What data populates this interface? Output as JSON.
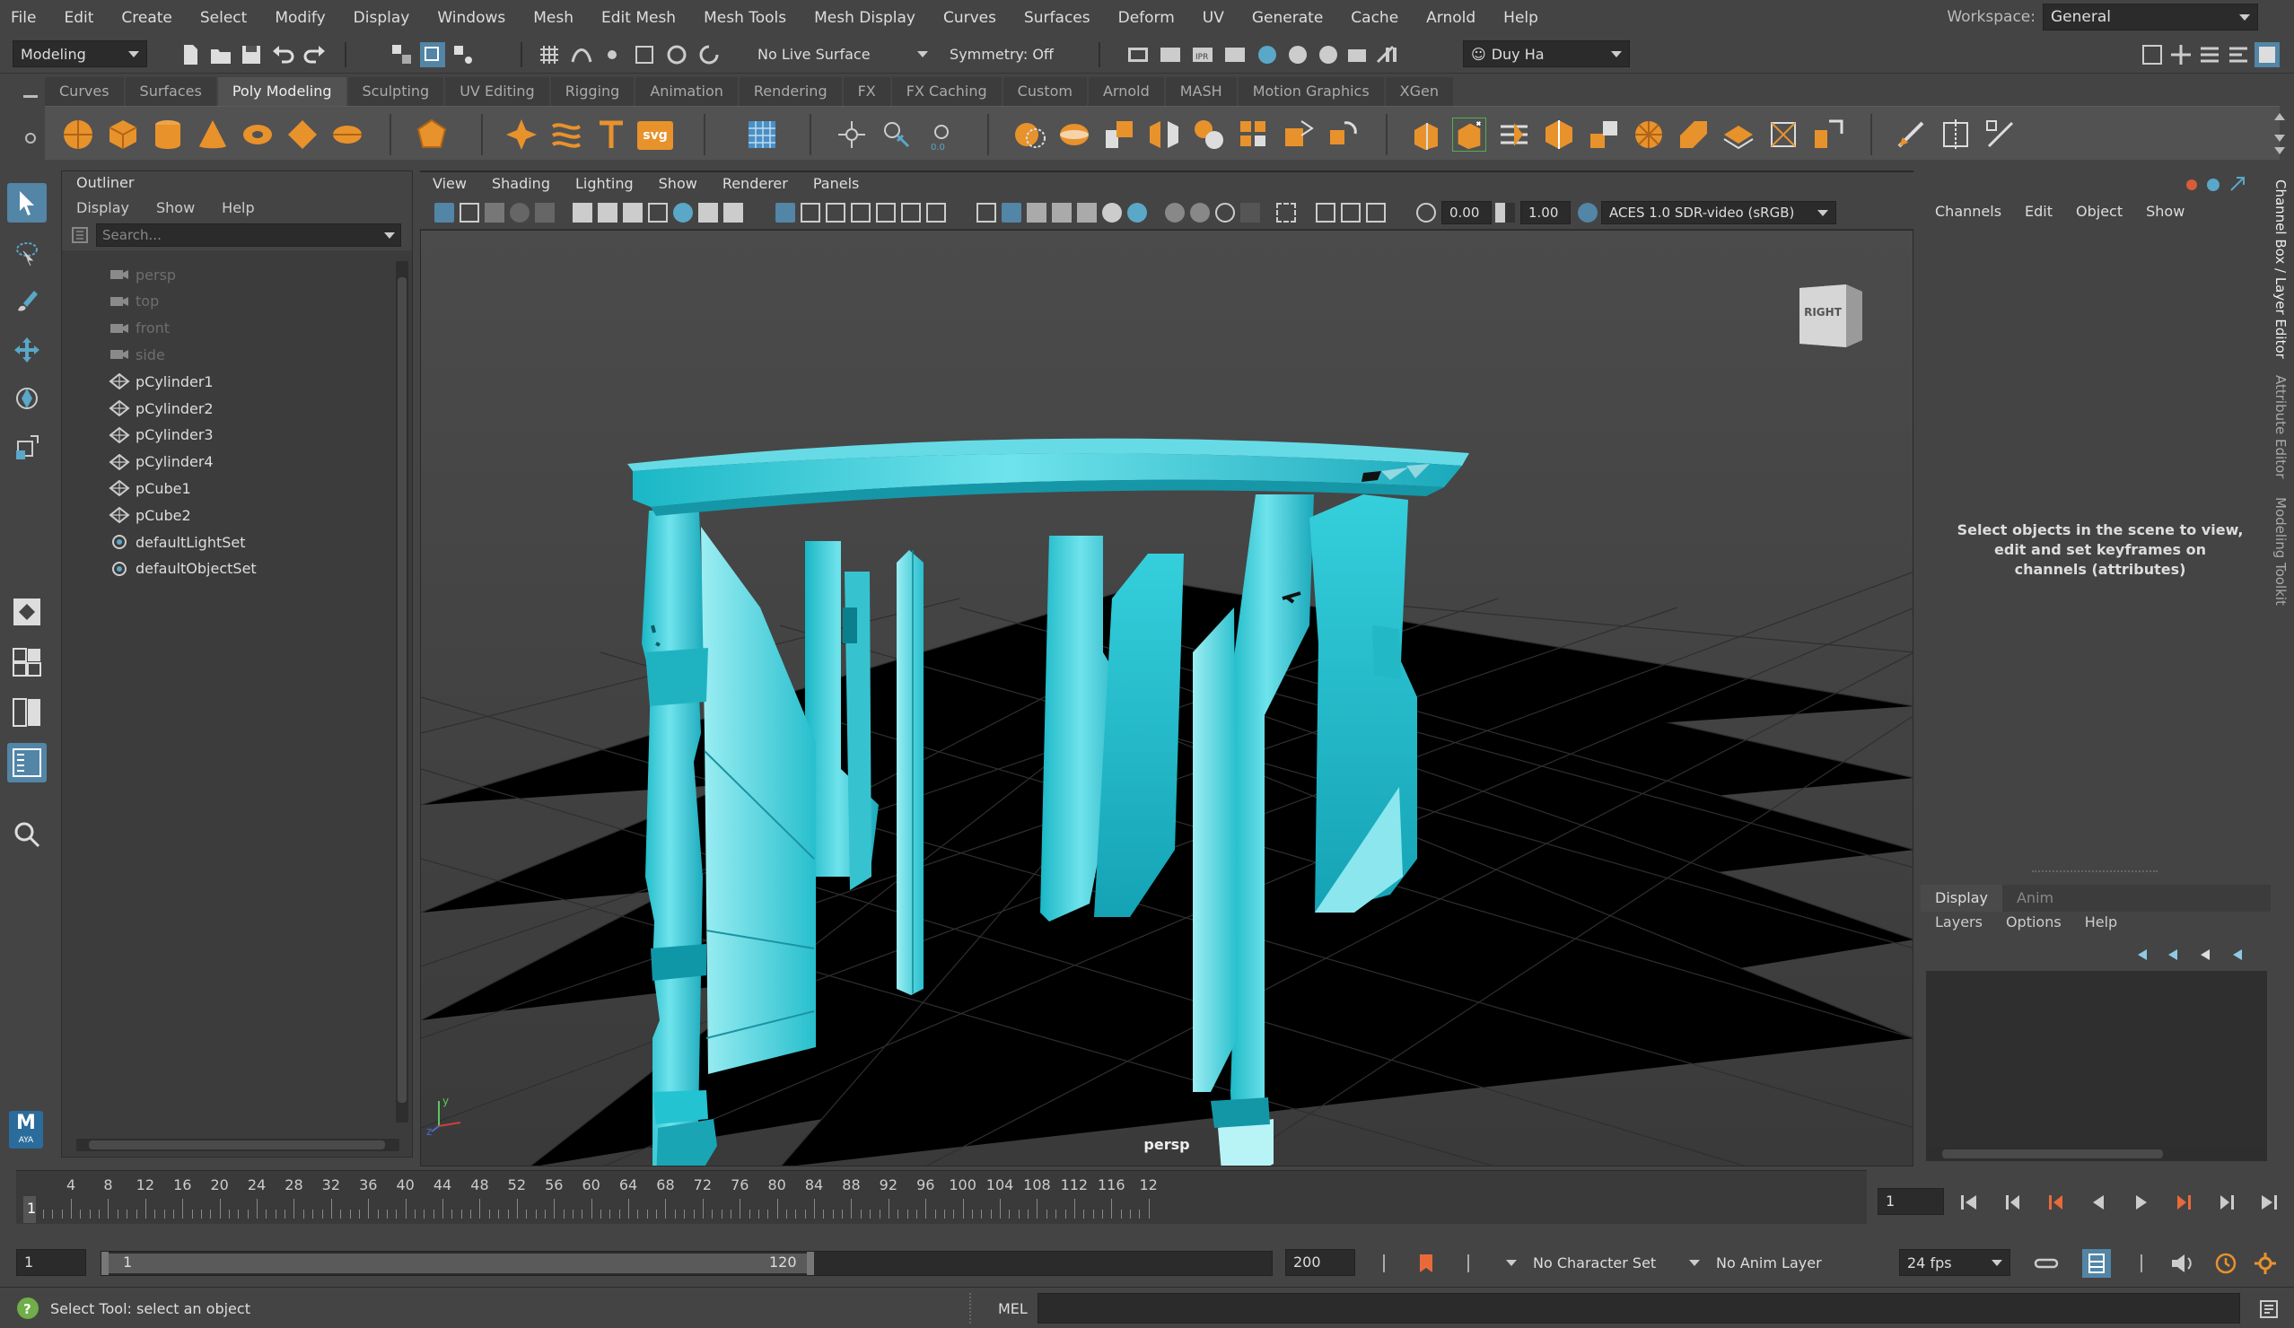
{
  "menubar": {
    "items": [
      "File",
      "Edit",
      "Create",
      "Select",
      "Modify",
      "Display",
      "Windows",
      "Mesh",
      "Edit Mesh",
      "Mesh Tools",
      "Mesh Display",
      "Curves",
      "Surfaces",
      "Deform",
      "UV",
      "Generate",
      "Cache",
      "Arnold",
      "Help"
    ],
    "workspace_label": "Workspace:",
    "workspace_value": "General"
  },
  "statusline": {
    "menuset": "Modeling",
    "live_surface": "No Live Surface",
    "symmetry": "Symmetry: Off",
    "user": "Duy Ha"
  },
  "shelf": {
    "tabs": [
      "Curves",
      "Surfaces",
      "Poly Modeling",
      "Sculpting",
      "UV Editing",
      "Rigging",
      "Animation",
      "Rendering",
      "FX",
      "FX Caching",
      "Custom",
      "Arnold",
      "MASH",
      "Motion Graphics",
      "XGen"
    ],
    "active_tab": "Poly Modeling",
    "accent_color": "#e8922c",
    "svg_label": "svg"
  },
  "outliner": {
    "title": "Outliner",
    "menu": [
      "Display",
      "Show",
      "Help"
    ],
    "search_placeholder": "Search...",
    "items": [
      {
        "label": "persp",
        "type": "camera",
        "dim": true
      },
      {
        "label": "top",
        "type": "camera",
        "dim": true
      },
      {
        "label": "front",
        "type": "camera",
        "dim": true
      },
      {
        "label": "side",
        "type": "camera",
        "dim": true
      },
      {
        "label": "pCylinder1",
        "type": "mesh",
        "dim": false
      },
      {
        "label": "pCylinder2",
        "type": "mesh",
        "dim": false
      },
      {
        "label": "pCylinder3",
        "type": "mesh",
        "dim": false
      },
      {
        "label": "pCylinder4",
        "type": "mesh",
        "dim": false
      },
      {
        "label": "pCube1",
        "type": "mesh",
        "dim": false
      },
      {
        "label": "pCube2",
        "type": "mesh",
        "dim": false
      },
      {
        "label": "defaultLightSet",
        "type": "set",
        "dim": false
      },
      {
        "label": "defaultObjectSet",
        "type": "set",
        "dim": false
      }
    ]
  },
  "viewport": {
    "menu": [
      "View",
      "Shading",
      "Lighting",
      "Show",
      "Renderer",
      "Panels"
    ],
    "exposure": "0.00",
    "gamma": "1.00",
    "color_space": "ACES 1.0 SDR-video (sRGB)",
    "camera_label": "persp",
    "viewcube_label": "RIGHT",
    "model_color": "#22c4d2"
  },
  "channelbox": {
    "menu": [
      "Channels",
      "Edit",
      "Object",
      "Show"
    ],
    "message": "Select objects in the scene to view, edit and set keyframes on channels (attributes)",
    "layer_tabs": [
      "Display",
      "Anim"
    ],
    "layer_menu": [
      "Layers",
      "Options",
      "Help"
    ]
  },
  "side_tabs": [
    "Channel Box / Layer Editor",
    "Attribute Editor",
    "Modeling Toolkit"
  ],
  "timeline": {
    "ticks": [
      "4",
      "8",
      "12",
      "16",
      "20",
      "24",
      "28",
      "32",
      "36",
      "40",
      "44",
      "48",
      "52",
      "56",
      "60",
      "64",
      "68",
      "72",
      "76",
      "80",
      "84",
      "88",
      "92",
      "96",
      "100",
      "104",
      "108",
      "112",
      "116",
      "12"
    ],
    "current_marker": "1",
    "current_frame": "1"
  },
  "range": {
    "start": "1",
    "inner_start": "1",
    "inner_end": "120",
    "end": "200",
    "character_set": "No Character Set",
    "anim_layer": "No Anim Layer",
    "fps": "24 fps"
  },
  "helpline": {
    "message": "Select Tool: select an object",
    "mel_label": "MEL"
  },
  "logo": {
    "letter": "M",
    "sub": "AYA"
  }
}
